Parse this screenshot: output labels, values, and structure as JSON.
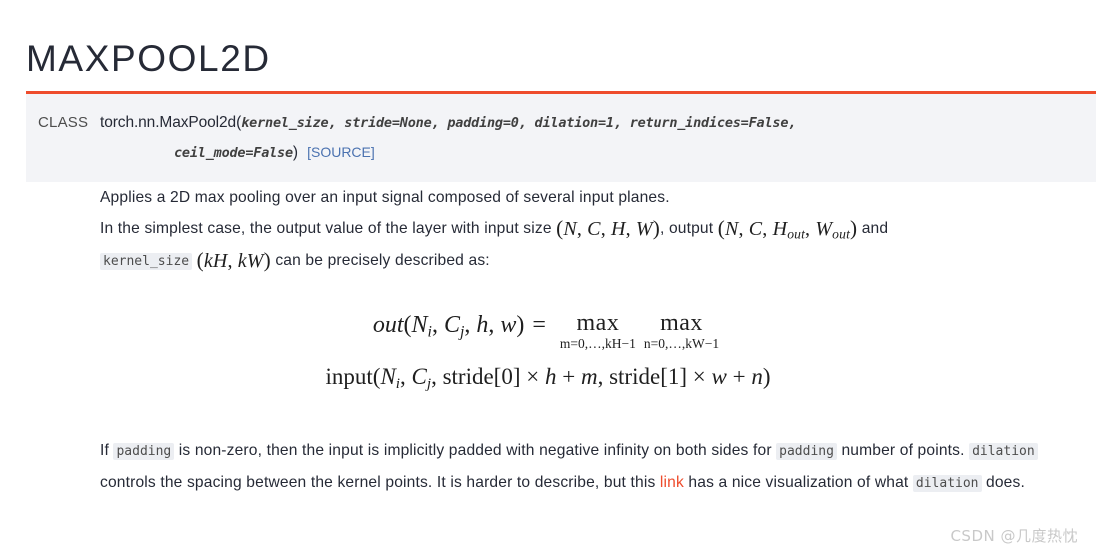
{
  "page": {
    "title": "MAXPOOL2D"
  },
  "signature": {
    "keyword": "CLASS",
    "qualname": "torch.nn.MaxPool2d",
    "open_paren": "(",
    "params_line1": "kernel_size, stride=None, padding=0, dilation=1, return_indices=False,",
    "params_line2": "ceil_mode=False",
    "close_paren": ")",
    "source_label": "[SOURCE]",
    "accent_color": "#ee4c2c",
    "background_color": "#f3f4f7",
    "link_color": "#4b72b0"
  },
  "body": {
    "paragraph1": "Applies a 2D max pooling over an input signal composed of several input planes.",
    "paragraph2": {
      "part1": "In the simplest case, the output value of the layer with input size ",
      "math_input_size": "(N, C, H, W)",
      "part2": ", output ",
      "math_output_size": "(N, C, H_out, W_out)",
      "part3": " and ",
      "code_kernel_size": "kernel_size",
      "math_kernel": "(kH, kW)",
      "part4": " can be precisely described as:"
    }
  },
  "equation": {
    "lhs": "out(N_i, C_j, h, w)",
    "equals": "=",
    "max1_op": "max",
    "max1_limits": "m=0,…,kH−1",
    "max2_op": "max",
    "max2_limits": "n=0,…,kW−1",
    "rhs": "input(N_i, C_j, stride[0] × h + m, stride[1] × w + n)"
  },
  "bottom_paragraph": {
    "part1": "If ",
    "code_padding_1": "padding",
    "part2": " is non-zero, then the input is implicitly padded with negative infinity on both sides for ",
    "code_padding_2": "padding",
    "part3": " number of points. ",
    "code_dilation_1": "dilation",
    "part4": " controls the spacing between the kernel points. It is harder to describe, but this ",
    "link_label": "link",
    "part5": " has a nice visualization of what ",
    "code_dilation_2": "dilation",
    "part6": " does.",
    "link_color": "#ee4c2c"
  },
  "watermark": {
    "text": "CSDN @几度热忱"
  }
}
